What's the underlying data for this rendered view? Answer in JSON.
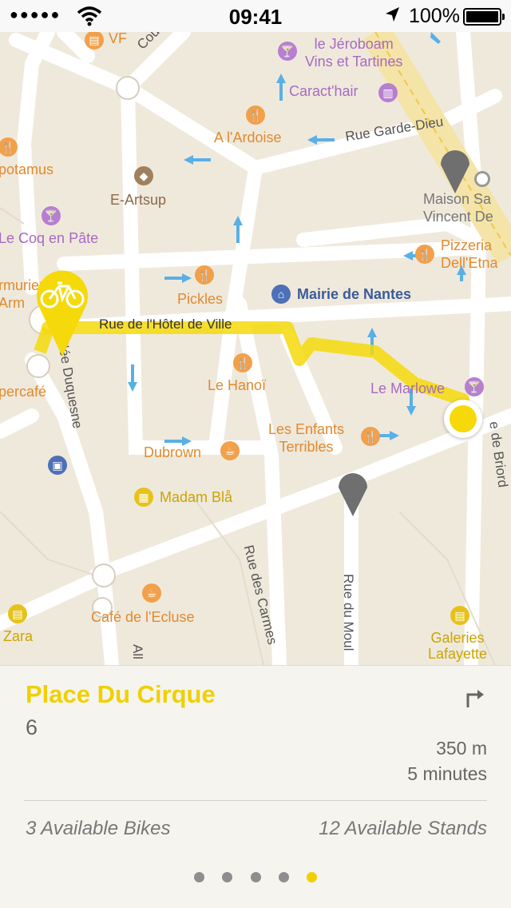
{
  "status_bar": {
    "signal": "●●●●●",
    "time": "09:41",
    "battery": "100%"
  },
  "map": {
    "pois": {
      "vf": "VF",
      "jeroboam": "le Jéroboam\nVins et Tartines",
      "caracthair": "Caract'hair",
      "ardoise": "A l'Ardoise",
      "potamus": "potamus",
      "eartsup": "E-Artsup",
      "coq": "Le Coq en Pâte",
      "maison": "Maison Sa\nVincent De",
      "pizzeria": "Pizzeria\nDell'Etna",
      "armurier": "rmurier\nArm",
      "pickles": "Pickles",
      "mairie": "Mairie de Nantes",
      "hanoi": "Le Hanoï",
      "marlowe": "Le Marlowe",
      "percafe": "percafé",
      "enfants": "Les Enfants\nTerribles",
      "dubrown": "Dubrown",
      "madam": "Madam Blå",
      "ecluse": "Café de l'Ecluse",
      "zara": "Zara",
      "galeries": "Galeries\nLafayette"
    },
    "streets": {
      "cours": "Cours de",
      "garde_dieu": "Rue Garde-Dieu",
      "hotel_de_ville": "Rue de l'Hôtel de Ville",
      "duquesne": "Allée Duquesne",
      "briord": "e de Briord",
      "carmes": "Rue des Carmes",
      "moulin": "Rue du Moul",
      "all": "All"
    }
  },
  "station": {
    "name": "Place Du Cirque",
    "number": "6",
    "distance": "350 m",
    "duration": "5 minutes",
    "available_bikes": "3 Available Bikes",
    "available_stands": "12 Available Stands"
  },
  "pager": {
    "pages": 5,
    "active": 4
  },
  "colors": {
    "accent": "#f0d000",
    "route": "#f5d90a",
    "user_location": "#f5d90a"
  }
}
